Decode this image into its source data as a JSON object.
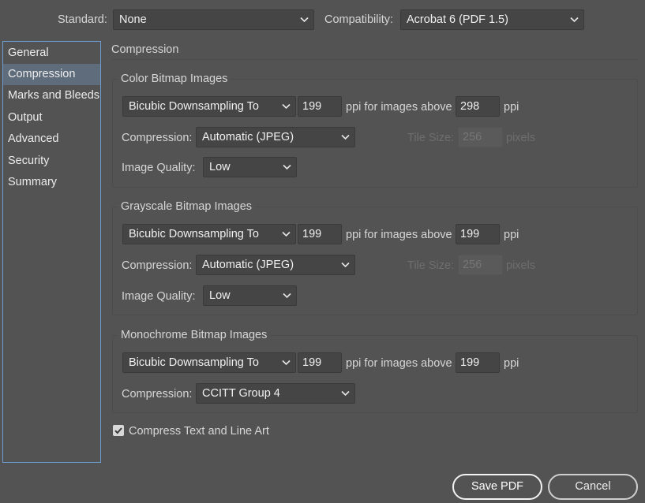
{
  "header": {
    "standard_label": "Standard:",
    "standard_value": "None",
    "compatibility_label": "Compatibility:",
    "compatibility_value": "Acrobat 6 (PDF 1.5)"
  },
  "sidebar": {
    "items": [
      {
        "label": "General"
      },
      {
        "label": "Compression"
      },
      {
        "label": "Marks and Bleeds"
      },
      {
        "label": "Output"
      },
      {
        "label": "Advanced"
      },
      {
        "label": "Security"
      },
      {
        "label": "Summary"
      }
    ],
    "selected": "Compression"
  },
  "panel": {
    "title": "Compression",
    "color": {
      "title": "Color Bitmap Images",
      "sampling": "Bicubic Downsampling To",
      "ppi_value": "199",
      "ppi_text": "ppi for images above",
      "above_value": "298",
      "ppi_suffix": "ppi",
      "compression_label": "Compression:",
      "compression_value": "Automatic (JPEG)",
      "tile_label": "Tile Size:",
      "tile_value": "256",
      "tile_unit": "pixels",
      "quality_label": "Image Quality:",
      "quality_value": "Low"
    },
    "grayscale": {
      "title": "Grayscale Bitmap Images",
      "sampling": "Bicubic Downsampling To",
      "ppi_value": "199",
      "ppi_text": "ppi for images above",
      "above_value": "199",
      "ppi_suffix": "ppi",
      "compression_label": "Compression:",
      "compression_value": "Automatic (JPEG)",
      "tile_label": "Tile Size:",
      "tile_value": "256",
      "tile_unit": "pixels",
      "quality_label": "Image Quality:",
      "quality_value": "Low"
    },
    "monochrome": {
      "title": "Monochrome Bitmap Images",
      "sampling": "Bicubic Downsampling To",
      "ppi_value": "199",
      "ppi_text": "ppi for images above",
      "above_value": "199",
      "ppi_suffix": "ppi",
      "compression_label": "Compression:",
      "compression_value": "CCITT Group 4"
    },
    "compress_text_label": "Compress Text and Line Art",
    "compress_text_checked": true
  },
  "buttons": {
    "save": "Save PDF",
    "cancel": "Cancel"
  }
}
